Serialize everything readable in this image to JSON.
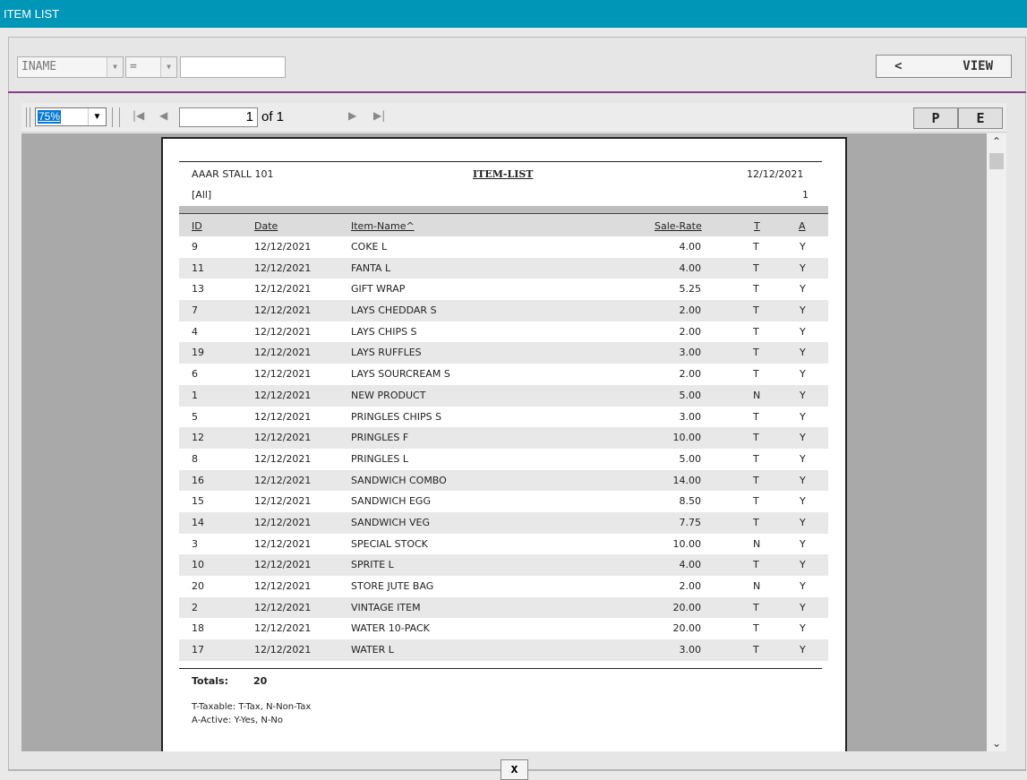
{
  "window": {
    "title": "ITEM LIST"
  },
  "filter": {
    "field": "INAME",
    "operator": "=",
    "value": "",
    "view_left": "<",
    "view_label": "VIEW"
  },
  "viewer": {
    "zoom": "75%",
    "page_current": "1",
    "page_of": "of 1",
    "p_label": "P",
    "e_label": "E"
  },
  "report": {
    "company": "AAAR STALL 101",
    "title": "ITEM-LIST",
    "date": "12/12/2021",
    "filter_text": "[All]",
    "page_number": "1",
    "columns": [
      "ID",
      "Date",
      "Item-Name^",
      "Sale-Rate",
      "T",
      "A"
    ],
    "rows": [
      {
        "id": "9",
        "date": "12/12/2021",
        "name": "COKE L",
        "rate": "4.00",
        "t": "T",
        "a": "Y"
      },
      {
        "id": "11",
        "date": "12/12/2021",
        "name": "FANTA L",
        "rate": "4.00",
        "t": "T",
        "a": "Y"
      },
      {
        "id": "13",
        "date": "12/12/2021",
        "name": "GIFT WRAP",
        "rate": "5.25",
        "t": "T",
        "a": "Y"
      },
      {
        "id": "7",
        "date": "12/12/2021",
        "name": "LAYS CHEDDAR S",
        "rate": "2.00",
        "t": "T",
        "a": "Y"
      },
      {
        "id": "4",
        "date": "12/12/2021",
        "name": "LAYS CHIPS S",
        "rate": "2.00",
        "t": "T",
        "a": "Y"
      },
      {
        "id": "19",
        "date": "12/12/2021",
        "name": "LAYS RUFFLES",
        "rate": "3.00",
        "t": "T",
        "a": "Y"
      },
      {
        "id": "6",
        "date": "12/12/2021",
        "name": "LAYS SOURCREAM S",
        "rate": "2.00",
        "t": "T",
        "a": "Y"
      },
      {
        "id": "1",
        "date": "12/12/2021",
        "name": "NEW PRODUCT",
        "rate": "5.00",
        "t": "N",
        "a": "Y"
      },
      {
        "id": "5",
        "date": "12/12/2021",
        "name": "PRINGLES CHIPS S",
        "rate": "3.00",
        "t": "T",
        "a": "Y"
      },
      {
        "id": "12",
        "date": "12/12/2021",
        "name": "PRINGLES F",
        "rate": "10.00",
        "t": "T",
        "a": "Y"
      },
      {
        "id": "8",
        "date": "12/12/2021",
        "name": "PRINGLES L",
        "rate": "5.00",
        "t": "T",
        "a": "Y"
      },
      {
        "id": "16",
        "date": "12/12/2021",
        "name": "SANDWICH COMBO",
        "rate": "14.00",
        "t": "T",
        "a": "Y"
      },
      {
        "id": "15",
        "date": "12/12/2021",
        "name": "SANDWICH EGG",
        "rate": "8.50",
        "t": "T",
        "a": "Y"
      },
      {
        "id": "14",
        "date": "12/12/2021",
        "name": "SANDWICH VEG",
        "rate": "7.75",
        "t": "T",
        "a": "Y"
      },
      {
        "id": "3",
        "date": "12/12/2021",
        "name": "SPECIAL STOCK",
        "rate": "10.00",
        "t": "N",
        "a": "Y"
      },
      {
        "id": "10",
        "date": "12/12/2021",
        "name": "SPRITE L",
        "rate": "4.00",
        "t": "T",
        "a": "Y"
      },
      {
        "id": "20",
        "date": "12/12/2021",
        "name": "STORE JUTE BAG",
        "rate": "2.00",
        "t": "N",
        "a": "Y"
      },
      {
        "id": "2",
        "date": "12/12/2021",
        "name": "VINTAGE ITEM",
        "rate": "20.00",
        "t": "T",
        "a": "Y"
      },
      {
        "id": "18",
        "date": "12/12/2021",
        "name": "WATER 10-PACK",
        "rate": "20.00",
        "t": "T",
        "a": "Y"
      },
      {
        "id": "17",
        "date": "12/12/2021",
        "name": "WATER L",
        "rate": "3.00",
        "t": "T",
        "a": "Y"
      }
    ],
    "totals_label": "Totals:",
    "totals_value": "20",
    "legend_taxable": "T-Taxable: T-Tax, N-Non-Tax",
    "legend_active": "A-Active: Y-Yes, N-No"
  },
  "footer": {
    "close_label": "x"
  }
}
